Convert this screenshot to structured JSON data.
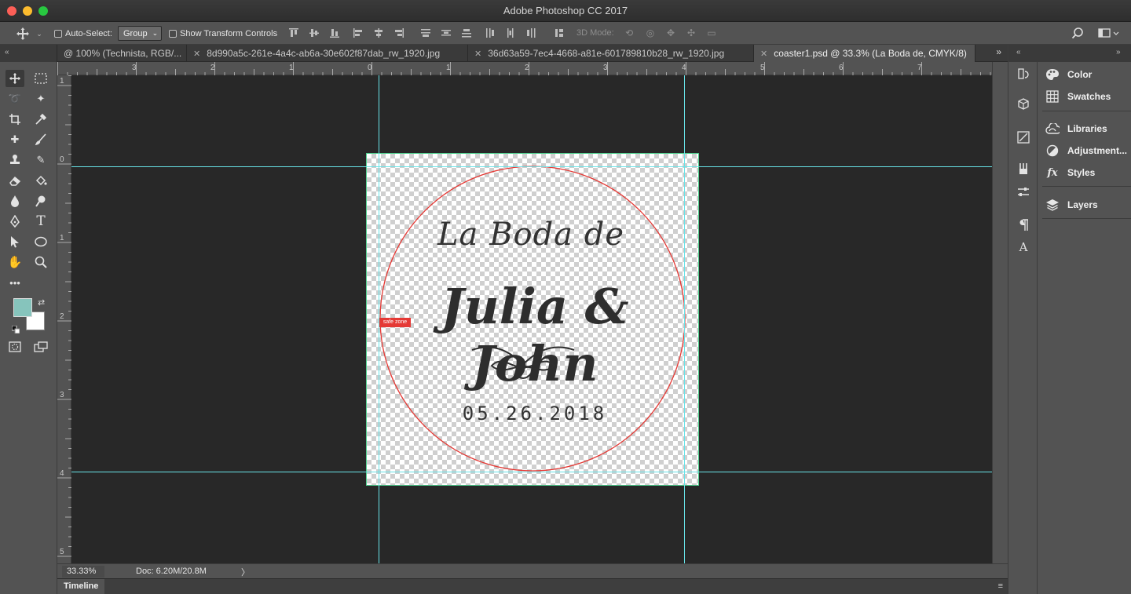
{
  "window": {
    "title": "Adobe Photoshop CC 2017"
  },
  "options_bar": {
    "auto_select_label": "Auto-Select:",
    "auto_select_value": "Group",
    "transform_controls_label": "Show Transform Controls",
    "mode_3d_label": "3D Mode:"
  },
  "tabs": [
    {
      "label": "@ 100% (Technista, RGB/..."
    },
    {
      "label": "8d990a5c-261e-4a4c-ab6a-30e602f87dab_rw_1920.jpg"
    },
    {
      "label": "36d63a59-7ec4-4668-a81e-601789810b28_rw_1920.jpg"
    },
    {
      "label": "coaster1.psd @ 33.3% (La Boda de, CMYK/8)"
    }
  ],
  "rulers": {
    "top": [
      "3",
      "2",
      "1",
      "0",
      "1",
      "2",
      "3",
      "4",
      "5",
      "6",
      "7"
    ],
    "left": [
      "1",
      "0",
      "1",
      "2",
      "3",
      "4",
      "5"
    ]
  },
  "canvas": {
    "line1": "La Boda de",
    "line2": "Julia & John",
    "date": "05.26.2018",
    "safe_zone_label": "safe zone"
  },
  "status": {
    "zoom": "33.33%",
    "doc": "Doc: 6.20M/20.8M",
    "arrow": "〉"
  },
  "timeline": {
    "label": "Timeline"
  },
  "panels": [
    {
      "label": "Color",
      "icon": "color-icon"
    },
    {
      "label": "Swatches",
      "icon": "swatches-icon"
    },
    {
      "label": "Libraries",
      "icon": "libraries-icon"
    },
    {
      "label": "Adjustment...",
      "icon": "adjustments-icon"
    },
    {
      "label": "Styles",
      "icon": "styles-icon"
    },
    {
      "label": "Layers",
      "icon": "layers-icon"
    }
  ],
  "colors": {
    "foreground": "#86c4bc",
    "background": "#ffffff",
    "safe_zone": "#e53935",
    "guides": "#68e3e8"
  }
}
